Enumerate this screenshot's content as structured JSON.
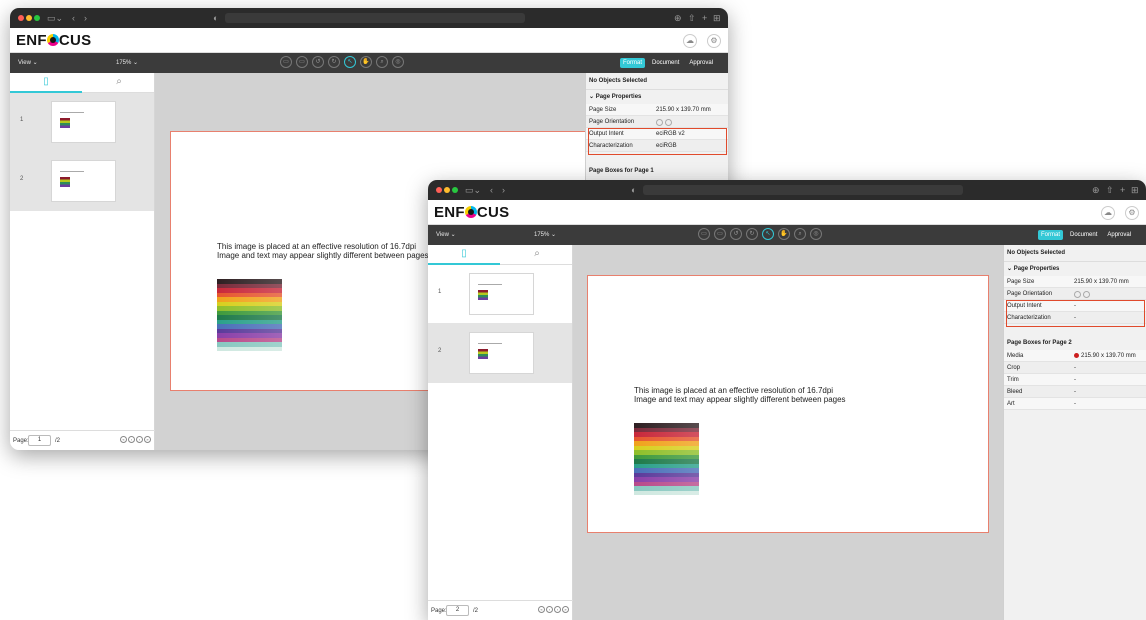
{
  "brand": {
    "logo_pre": "ENF",
    "logo_post": "CUS"
  },
  "toolbar": {
    "view_label": "View ⌄",
    "zoom_label": "175% ⌄"
  },
  "tabs": [
    "Format",
    "Document",
    "Approval"
  ],
  "thumbs": [
    {
      "number": "1"
    },
    {
      "number": "2"
    }
  ],
  "page_text": {
    "line1": "This image is placed at an effective resolution of 16.7dpi",
    "line2": "Image and text may appear slightly different between pages"
  },
  "swatch_colors": [
    "#2e1f22",
    "#7a2a3a",
    "#c8283a",
    "#e6562e",
    "#f0a21c",
    "#d8cf1e",
    "#8fbf2a",
    "#3f9a3c",
    "#1e7a4a",
    "#2aa08a",
    "#4a6fb8",
    "#5a3a9a",
    "#8a3fa8",
    "#b84a8a",
    "#88c8c0",
    "#cfe8e0"
  ],
  "window1": {
    "panel": {
      "no_selection": "No Objects Selected",
      "section": "⌄  Page Properties",
      "props": [
        {
          "k": "Page Size",
          "v": "215.90 x 139.70 mm"
        },
        {
          "k": "Page Orientation",
          "v": ""
        },
        {
          "k": "Output Intent",
          "v": "eciRGB v2"
        },
        {
          "k": "Characterization",
          "v": "eciRGB"
        }
      ],
      "boxes_title": "Page Boxes for Page 1"
    },
    "pager": {
      "label": "Page:",
      "current": "1",
      "total": "/2"
    }
  },
  "window2": {
    "panel": {
      "no_selection": "No Objects Selected",
      "section": "⌄  Page Properties",
      "props": [
        {
          "k": "Page Size",
          "v": "215.90 x 139.70 mm"
        },
        {
          "k": "Page Orientation",
          "v": ""
        },
        {
          "k": "Output Intent",
          "v": "-"
        },
        {
          "k": "Characterization",
          "v": "-"
        }
      ],
      "boxes_title": "Page Boxes for Page 2",
      "boxes": [
        {
          "k": "Media",
          "v": "215.90 x 139.70 mm"
        },
        {
          "k": "Crop",
          "v": "-"
        },
        {
          "k": "Trim",
          "v": "-"
        },
        {
          "k": "Bleed",
          "v": "-"
        },
        {
          "k": "Art",
          "v": "-"
        }
      ]
    },
    "pager": {
      "label": "Page:",
      "current": "2",
      "total": "/2"
    }
  }
}
